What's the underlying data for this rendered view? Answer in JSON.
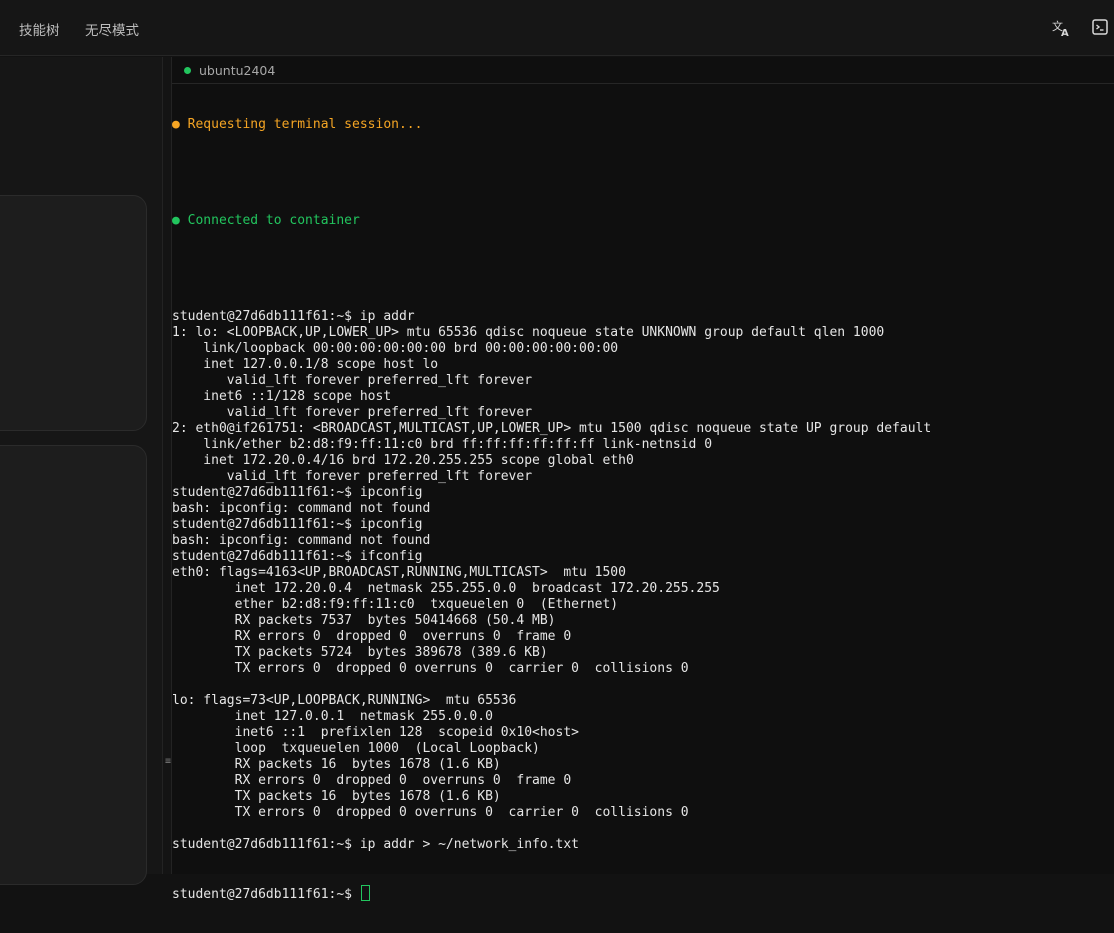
{
  "topbar": {
    "nav": [
      "技能树",
      "无尽模式"
    ],
    "icons": [
      "translate-icon",
      "terminal-panel-icon"
    ]
  },
  "terminal": {
    "tab_label": "ubuntu2404",
    "status_requesting": "● Requesting terminal session...",
    "status_connected": "● Connected to container",
    "lines": [
      "student@27d6db111f61:~$ ip addr",
      "1: lo: <LOOPBACK,UP,LOWER_UP> mtu 65536 qdisc noqueue state UNKNOWN group default qlen 1000",
      "    link/loopback 00:00:00:00:00:00 brd 00:00:00:00:00:00",
      "    inet 127.0.0.1/8 scope host lo",
      "       valid_lft forever preferred_lft forever",
      "    inet6 ::1/128 scope host",
      "       valid_lft forever preferred_lft forever",
      "2: eth0@if261751: <BROADCAST,MULTICAST,UP,LOWER_UP> mtu 1500 qdisc noqueue state UP group default",
      "    link/ether b2:d8:f9:ff:11:c0 brd ff:ff:ff:ff:ff:ff link-netnsid 0",
      "    inet 172.20.0.4/16 brd 172.20.255.255 scope global eth0",
      "       valid_lft forever preferred_lft forever",
      "student@27d6db111f61:~$ ipconfig",
      "bash: ipconfig: command not found",
      "student@27d6db111f61:~$ ipconfig",
      "bash: ipconfig: command not found",
      "student@27d6db111f61:~$ ifconfig",
      "eth0: flags=4163<UP,BROADCAST,RUNNING,MULTICAST>  mtu 1500",
      "        inet 172.20.0.4  netmask 255.255.0.0  broadcast 172.20.255.255",
      "        ether b2:d8:f9:ff:11:c0  txqueuelen 0  (Ethernet)",
      "        RX packets 7537  bytes 50414668 (50.4 MB)",
      "        RX errors 0  dropped 0  overruns 0  frame 0",
      "        TX packets 5724  bytes 389678 (389.6 KB)",
      "        TX errors 0  dropped 0 overruns 0  carrier 0  collisions 0",
      "",
      "lo: flags=73<UP,LOOPBACK,RUNNING>  mtu 65536",
      "        inet 127.0.0.1  netmask 255.0.0.0",
      "        inet6 ::1  prefixlen 128  scopeid 0x10<host>",
      "        loop  txqueuelen 1000  (Local Loopback)",
      "        RX packets 16  bytes 1678 (1.6 KB)",
      "        RX errors 0  dropped 0  overruns 0  frame 0",
      "        TX packets 16  bytes 1678 (1.6 KB)",
      "        TX errors 0  dropped 0 overruns 0  carrier 0  collisions 0",
      "",
      "student@27d6db111f61:~$ ip addr > ~/network_info.txt"
    ],
    "prompt": "student@27d6db111f61:~$ "
  },
  "colors": {
    "status_orange": "#f5a524",
    "status_green": "#22c55e",
    "terminal_text": "#e6e6e6",
    "background": "#121212"
  }
}
